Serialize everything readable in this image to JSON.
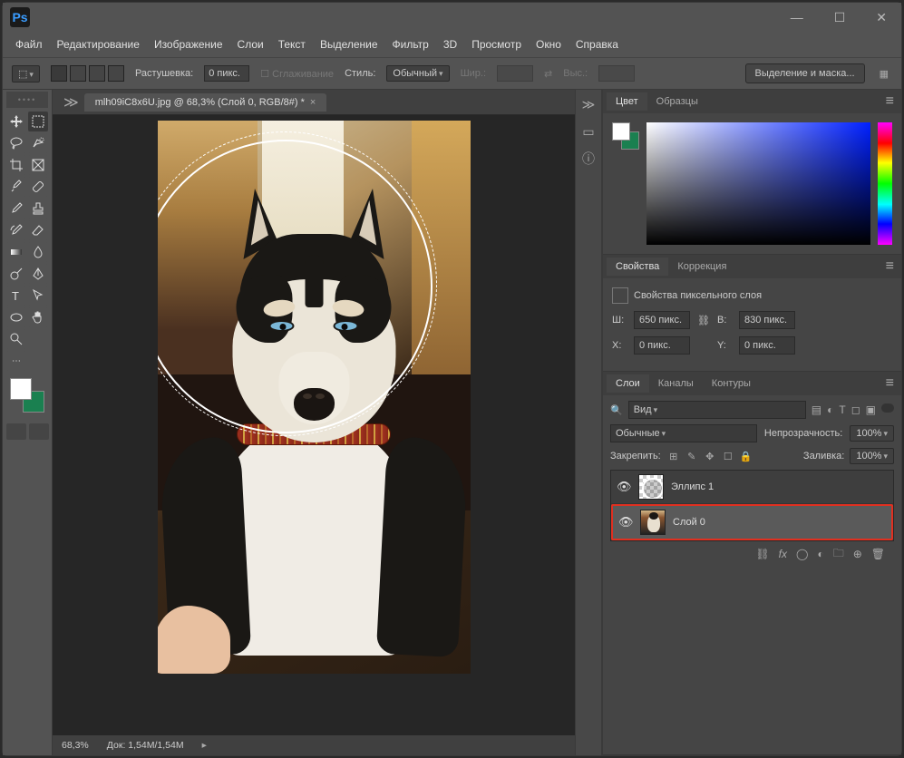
{
  "titlebar": {
    "app_initials": "Ps"
  },
  "menubar": [
    "Файл",
    "Редактирование",
    "Изображение",
    "Слои",
    "Текст",
    "Выделение",
    "Фильтр",
    "3D",
    "Просмотр",
    "Окно",
    "Справка"
  ],
  "options": {
    "feather_label": "Растушевка:",
    "feather_value": "0 пикс.",
    "antialias": "Сглаживание",
    "style_label": "Стиль:",
    "style_value": "Обычный",
    "width_label": "Шир.:",
    "height_label": "Выс.:",
    "select_mask": "Выделение и маска..."
  },
  "document": {
    "tab_title": "mlh09iC8x6U.jpg @ 68,3% (Слой 0, RGB/8#) *",
    "zoom": "68,3%",
    "doc_size_label": "Док:",
    "doc_size": "1,54M/1,54M"
  },
  "panels": {
    "color_tab": "Цвет",
    "swatches_tab": "Образцы",
    "properties_tab": "Свойства",
    "adjustments_tab": "Коррекция",
    "properties_title": "Свойства пиксельного слоя",
    "prop_w_label": "Ш:",
    "prop_w": "650 пикс.",
    "prop_h_label": "В:",
    "prop_h": "830 пикс.",
    "prop_x_label": "X:",
    "prop_x": "0 пикс.",
    "prop_y_label": "Y:",
    "prop_y": "0 пикс.",
    "layers_tab": "Слои",
    "channels_tab": "Каналы",
    "paths_tab": "Контуры",
    "search_kind": "Вид",
    "blend_mode": "Обычные",
    "opacity_label": "Непрозрачность:",
    "opacity_value": "100%",
    "lock_label": "Закрепить:",
    "fill_label": "Заливка:",
    "fill_value": "100%",
    "layer1_name": "Эллипс 1",
    "layer0_name": "Слой 0"
  }
}
